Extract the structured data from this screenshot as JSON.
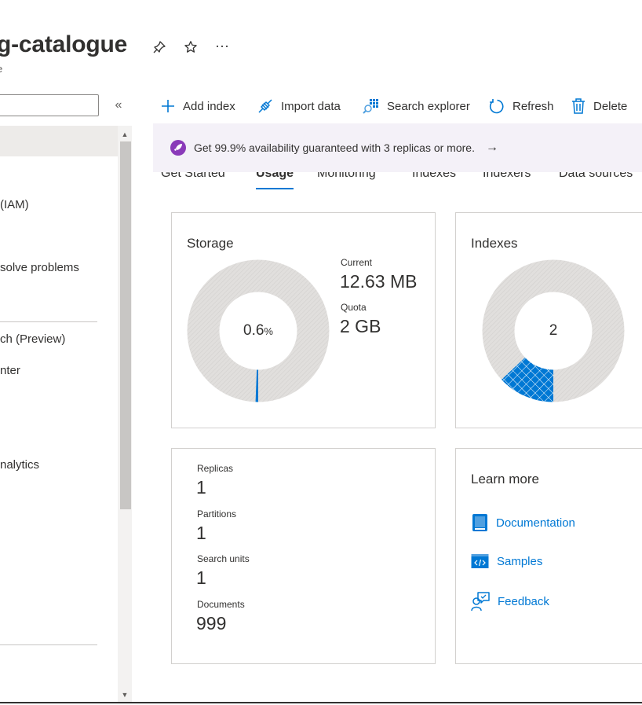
{
  "header": {
    "title": "g-catalogue",
    "subtitle": "e",
    "icons": [
      "pin-icon",
      "star-icon",
      "more-icon"
    ],
    "more_glyph": "···"
  },
  "sidebar": {
    "collapse_glyph": "«",
    "items": [
      {
        "label": "(IAM)"
      },
      {
        "label": "solve problems"
      },
      {
        "label": "ch (Preview)"
      },
      {
        "label": "nter"
      },
      {
        "label": "nalytics"
      }
    ]
  },
  "toolbar": {
    "add_index": "Add index",
    "import_data": "Import data",
    "search_explorer": "Search explorer",
    "refresh": "Refresh",
    "delete": "Delete"
  },
  "banner": {
    "text": "Get 99.9% availability guaranteed with 3 replicas or more.",
    "arrow": "→"
  },
  "tabs": [
    {
      "label": "Get Started"
    },
    {
      "label": "Usage",
      "active": true
    },
    {
      "label": "Monitoring"
    },
    {
      "label": "Indexes"
    },
    {
      "label": "Indexers"
    },
    {
      "label": "Data sources"
    }
  ],
  "storage": {
    "title": "Storage",
    "percent_value": "0.6",
    "percent_sign": "%",
    "used_fraction": 0.006,
    "current_label": "Current",
    "current_value": "12.63 MB",
    "quota_label": "Quota",
    "quota_value": "2 GB"
  },
  "indexes": {
    "title": "Indexes",
    "count": "2",
    "used_fraction": 0.13
  },
  "stats": {
    "replicas_label": "Replicas",
    "replicas_value": "1",
    "partitions_label": "Partitions",
    "partitions_value": "1",
    "search_units_label": "Search units",
    "search_units_value": "1",
    "documents_label": "Documents",
    "documents_value": "999"
  },
  "learn_more": {
    "title": "Learn more",
    "documentation": "Documentation",
    "samples": "Samples",
    "feedback": "Feedback"
  },
  "colors": {
    "accent": "#0078d4",
    "banner_bg": "#f4f1f8",
    "rocket": "#8a3ab9",
    "donut_track": "#dddcdb"
  }
}
